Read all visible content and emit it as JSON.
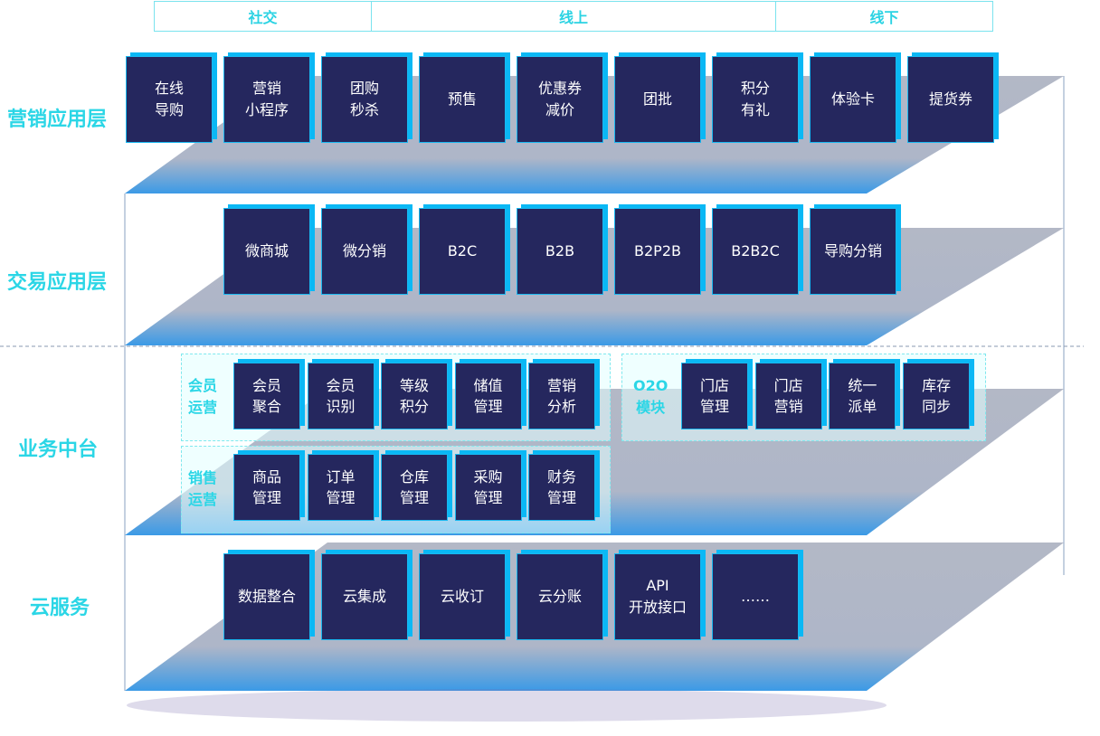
{
  "header": {
    "social": "社交",
    "online": "线上",
    "offline": "线下"
  },
  "colors": {
    "accent": "#2bd6e6",
    "box": "#25275e",
    "box_shadow": "#0ab8f5"
  },
  "layers": {
    "marketing": {
      "label": "营销应用层",
      "items": [
        "在线\n导购",
        "营销\n小程序",
        "团购\n秒杀",
        "预售",
        "优惠券\n减价",
        "团批",
        "积分\n有礼",
        "体验卡",
        "提货券"
      ]
    },
    "trade": {
      "label": "交易应用层",
      "items": [
        "微商城",
        "微分销",
        "B2C",
        "B2B",
        "B2P2B",
        "B2B2C",
        "导购分销"
      ]
    },
    "business": {
      "label": "业务中台",
      "member": {
        "label": "会员\n运营",
        "items": [
          "会员\n聚合",
          "会员\n识别",
          "等级\n积分",
          "储值\n管理",
          "营销\n分析"
        ]
      },
      "sales": {
        "label": "销售\n运营",
        "items": [
          "商品\n管理",
          "订单\n管理",
          "仓库\n管理",
          "采购\n管理",
          "财务\n管理"
        ]
      },
      "o2o": {
        "label": "O2O\n模块",
        "items": [
          "门店\n管理",
          "门店\n营销",
          "统一\n派单",
          "库存\n同步"
        ]
      }
    },
    "cloud": {
      "label": "云服务",
      "items": [
        "数据整合",
        "云集成",
        "云收订",
        "云分账",
        "API\n开放接口",
        "……"
      ]
    }
  }
}
